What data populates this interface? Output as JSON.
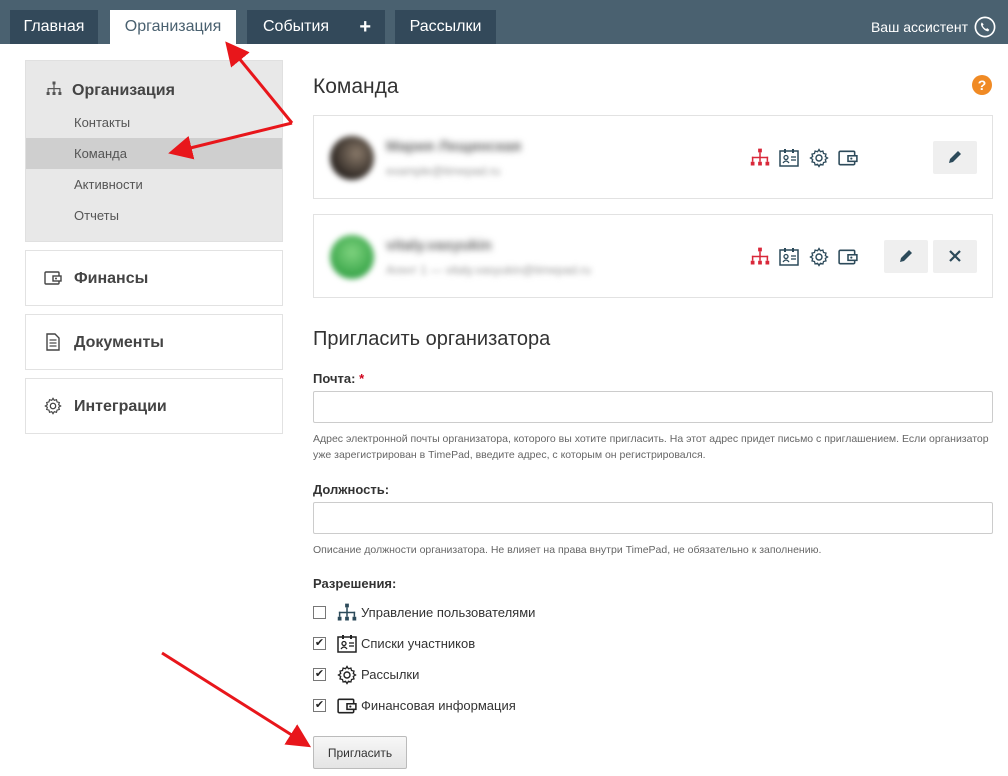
{
  "nav": {
    "tabs": [
      {
        "label": "Главная"
      },
      {
        "label": "Организация"
      },
      {
        "label": "События"
      },
      {
        "label": "Рассылки"
      }
    ],
    "events_plus": "+",
    "assistant": "Ваш ассистент"
  },
  "sidebar": {
    "org_title": "Организация",
    "org_items": [
      {
        "label": "Контакты"
      },
      {
        "label": "Команда"
      },
      {
        "label": "Активности"
      },
      {
        "label": "Отчеты"
      }
    ],
    "finance": "Финансы",
    "documents": "Документы",
    "integrations": "Интеграции"
  },
  "team": {
    "title": "Команда",
    "help": "?",
    "members": [
      {
        "name": "Мария Лещинская",
        "email": "example@timepad.ru"
      },
      {
        "name": "vitaly.vasyukin",
        "email": "Агент 1 — vitaly.vasyukin@timepad.ru"
      }
    ]
  },
  "invite": {
    "title": "Пригласить организатора",
    "email_label": "Почта:",
    "required_mark": "*",
    "email_value": "",
    "email_hint": "Адрес электронной почты организатора, которого вы хотите пригласить. На этот адрес придет письмо с приглашением. Если организатор уже зарегистрирован в TimePad, введите адрес, с которым он регистрировался.",
    "position_label": "Должность:",
    "position_value": "",
    "position_hint": "Описание должности организатора. Не влияет на права внутри TimePad, не обязательно к заполнению.",
    "permissions_label": "Разрешения:",
    "permissions": [
      {
        "label": "Управление пользователями",
        "checked": false,
        "icon": "org-chart-icon"
      },
      {
        "label": "Списки участников",
        "checked": true,
        "icon": "id-card-icon"
      },
      {
        "label": "Рассылки",
        "checked": true,
        "icon": "gear-icon"
      },
      {
        "label": "Финансовая информация",
        "checked": true,
        "icon": "wallet-icon"
      }
    ],
    "submit": "Пригласить"
  },
  "colors": {
    "nav_bg": "#4a6170",
    "tab_bg": "#33495a",
    "accent_red": "#d9283a",
    "icon_teal": "#2c4a5a",
    "help_orange": "#f08a24",
    "annotation_arrow": "#e8161b"
  }
}
